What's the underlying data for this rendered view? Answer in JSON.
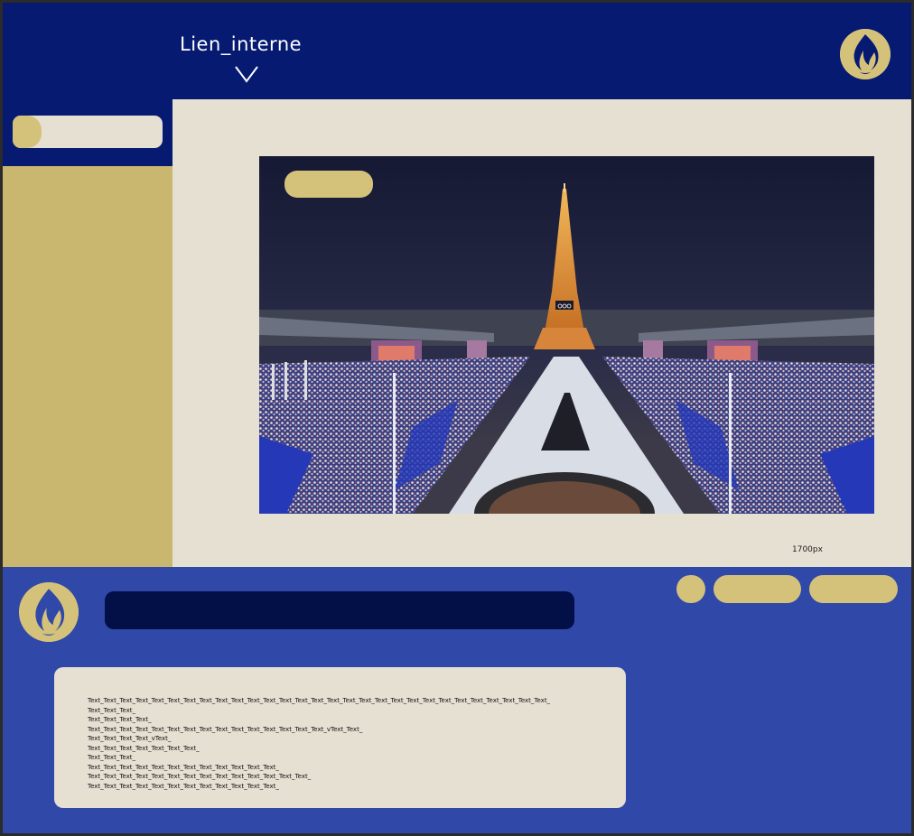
{
  "header": {
    "nav_link": "Lien_interne",
    "chevron_icon": "chevron-down-icon",
    "logo_icon": "flame-logo-icon"
  },
  "sidebar": {
    "toggle_icon": "toggle-pill"
  },
  "main": {
    "image_caption": "1700px"
  },
  "footer": {
    "logo_icon": "flame-logo-icon",
    "text_lines": [
      "Text_Text_Text_Text_Text_Text_Text_Text_Text_Text_Text_Text_Text_Text_Text_Text_Text_Text_Text_Text_Text_Text_Text_Text_Text_Text_Text_Text_Text_",
      "Text_Text_Text_",
      "Text_Text_Text_Text_",
      "Text_Text_Text_Text_Text_Text_Text_Text_Text_Text_Text_Text_Text_Text_Text_vText_Text_",
      "Text_Text_Text_Text_vText_",
      "Text_Text_Text_Text_Text_Text_Text_",
      "Text_Text_Text_",
      "Text_Text_Text_Text_Text_Text_Text_Text_Text_Text_Text_Text_",
      "Text_Text_Text_Text_Text_Text_Text_Text_Text_Text_Text_Text_Text_Text_",
      "Text_Text_Text_Text_Text_Text_Text_Text_Text_Text_Text_Text_"
    ]
  },
  "colors": {
    "navy": "#061a72",
    "gold": "#d5c27a",
    "sand": "#c9b66f",
    "cream": "#e6e0d3",
    "royal_blue": "#3049a8",
    "dark_navy": "#030f47"
  }
}
